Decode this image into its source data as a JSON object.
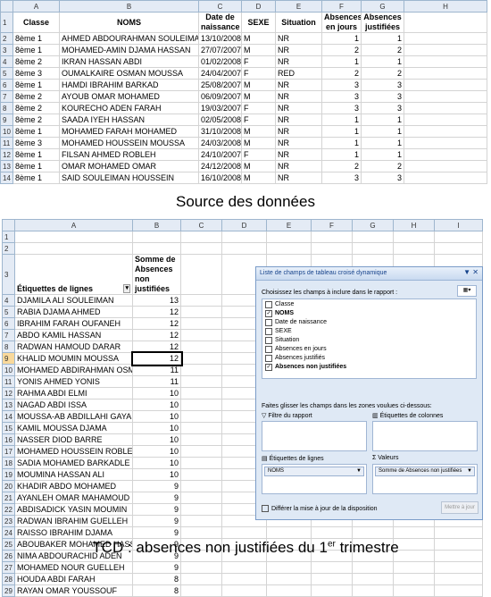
{
  "top_sheet": {
    "columns": [
      "A",
      "B",
      "C",
      "D",
      "E",
      "F",
      "G",
      "H"
    ],
    "headers": [
      "Classe",
      "NOMS",
      "Date de naissance",
      "SEXE",
      "Situation",
      "Absences en jours",
      "Absences justifiées"
    ],
    "rows": [
      [
        "8ème 1",
        "AHMED ABDOURAHMAN SOULEIMAN",
        "13/10/2008",
        "M",
        "NR",
        "1",
        "1"
      ],
      [
        "8ème 1",
        "MOHAMED-AMIN DJAMA HASSAN",
        "27/07/2007",
        "M",
        "NR",
        "2",
        "2"
      ],
      [
        "8ème 2",
        "IKRAN HASSAN ABDI",
        "01/02/2008",
        "F",
        "NR",
        "1",
        "1"
      ],
      [
        "8ème 3",
        "OUMALKAIRE OSMAN MOUSSA",
        "24/04/2007",
        "F",
        "RED",
        "2",
        "2"
      ],
      [
        "8ème 1",
        "HAMDI IBRAHIM BARKAD",
        "25/08/2007",
        "M",
        "NR",
        "3",
        "3"
      ],
      [
        "8ème 2",
        "AYOUB OMAR MOHAMED",
        "06/09/2007",
        "M",
        "NR",
        "3",
        "3"
      ],
      [
        "8ème 2",
        "KOURECHO ADEN FARAH",
        "19/03/2007",
        "F",
        "NR",
        "3",
        "3"
      ],
      [
        "8ème 2",
        "SAADA IYEH HASSAN",
        "02/05/2008",
        "F",
        "NR",
        "1",
        "1"
      ],
      [
        "8ème 1",
        "MOHAMED FARAH MOHAMED",
        "31/10/2008",
        "M",
        "NR",
        "1",
        "1"
      ],
      [
        "8ème 3",
        "MOHAMED HOUSSEIN MOUSSA",
        "24/03/2008",
        "M",
        "NR",
        "1",
        "1"
      ],
      [
        "8ème 1",
        "FILSAN AHMED ROBLEH",
        "24/10/2007",
        "F",
        "NR",
        "1",
        "1"
      ],
      [
        "8ème 1",
        "OMAR MOHAMED OMAR",
        "24/12/2008",
        "M",
        "NR",
        "2",
        "2"
      ],
      [
        "8ème 1",
        "SAID SOULEIMAN HOUSSEIN",
        "16/10/2008",
        "M",
        "NR",
        "3",
        "3"
      ]
    ]
  },
  "caption_top": "Source des données",
  "bottom_sheet": {
    "columns": [
      "A",
      "B",
      "C",
      "D",
      "E",
      "F",
      "G",
      "H",
      "I"
    ],
    "header_label": "Étiquettes de lignes",
    "header_value": "Somme de Absences non justifiées",
    "selected_row": 9,
    "rows": [
      [
        "DJAMILA ALI SOULEIMAN",
        "13"
      ],
      [
        "RABIA DJAMA AHMED",
        "12"
      ],
      [
        "IBRAHIM FARAH OUFANEH",
        "12"
      ],
      [
        "ABDO KAMIL HASSAN",
        "12"
      ],
      [
        "RADWAN HAMOUD DARAR",
        "12"
      ],
      [
        "KHALID MOUMIN MOUSSA",
        "12"
      ],
      [
        "MOHAMED ABDIRAHMAN OSMAN",
        "11"
      ],
      [
        "YONIS AHMED YONIS",
        "11"
      ],
      [
        "RAHMA ABDI ELMI",
        "10"
      ],
      [
        "NAGAD ABDI ISSA",
        "10"
      ],
      [
        "MOUSSA-AB ABDILLAHI GAYAD",
        "10"
      ],
      [
        "KAMIL MOUSSA DJAMA",
        "10"
      ],
      [
        "NASSER DIOD BARRE",
        "10"
      ],
      [
        "MOHAMED HOUSSEIN ROBLEH",
        "10"
      ],
      [
        "SADIA MOHAMED BARKADLE",
        "10"
      ],
      [
        "MOUMINA HASSAN ALI",
        "10"
      ],
      [
        "KHADIR ABDO MOHAMED",
        "9"
      ],
      [
        "AYANLEH OMAR MAHAMOUD",
        "9"
      ],
      [
        "ABDISADICK YASIN MOUMIN",
        "9"
      ],
      [
        "RADWAN IBRAHIM GUELLEH",
        "9"
      ],
      [
        "RAISSO IBRAHIM DJAMA",
        "9"
      ],
      [
        "ABOUBAKER MOHAMED HASSAN",
        "9"
      ],
      [
        "NIMA ABDOURACHID ADEN",
        "9"
      ],
      [
        "MOHAMED NOUR GUELLEH",
        "9"
      ],
      [
        "HOUDA ABDI FARAH",
        "8"
      ],
      [
        "RAYAN OMAR YOUSSOUF",
        "8"
      ]
    ]
  },
  "pivot_pane": {
    "title": "Liste de champs de tableau croisé dynamique",
    "choose_label": "Choisissez les champs à inclure dans le rapport :",
    "fields": [
      {
        "label": "Classe",
        "checked": false
      },
      {
        "label": "NOMS",
        "checked": true
      },
      {
        "label": "Date de naissance",
        "checked": false
      },
      {
        "label": "SEXE",
        "checked": false
      },
      {
        "label": "Situation",
        "checked": false
      },
      {
        "label": "Absences en jours",
        "checked": false
      },
      {
        "label": "Absences justifiés",
        "checked": false
      },
      {
        "label": "Absences non justifiées",
        "checked": true
      }
    ],
    "drag_label": "Faites glisser les champs dans les zones voulues ci-dessous:",
    "filter_label": "Filtre du rapport",
    "columns_label": "Étiquettes de colonnes",
    "rows_label": "Étiquettes de lignes",
    "values_label": "Valeurs",
    "rows_item": "NOMS",
    "values_item": "Somme de Absences non justifiées",
    "defer_label": "Différer la mise à jour de la disposition",
    "update_button": "Mettre à jour"
  },
  "caption_bottom_main": "TCD : absences non justifiées du 1",
  "caption_bottom_sup": "er",
  "caption_bottom_end": " trimestre"
}
